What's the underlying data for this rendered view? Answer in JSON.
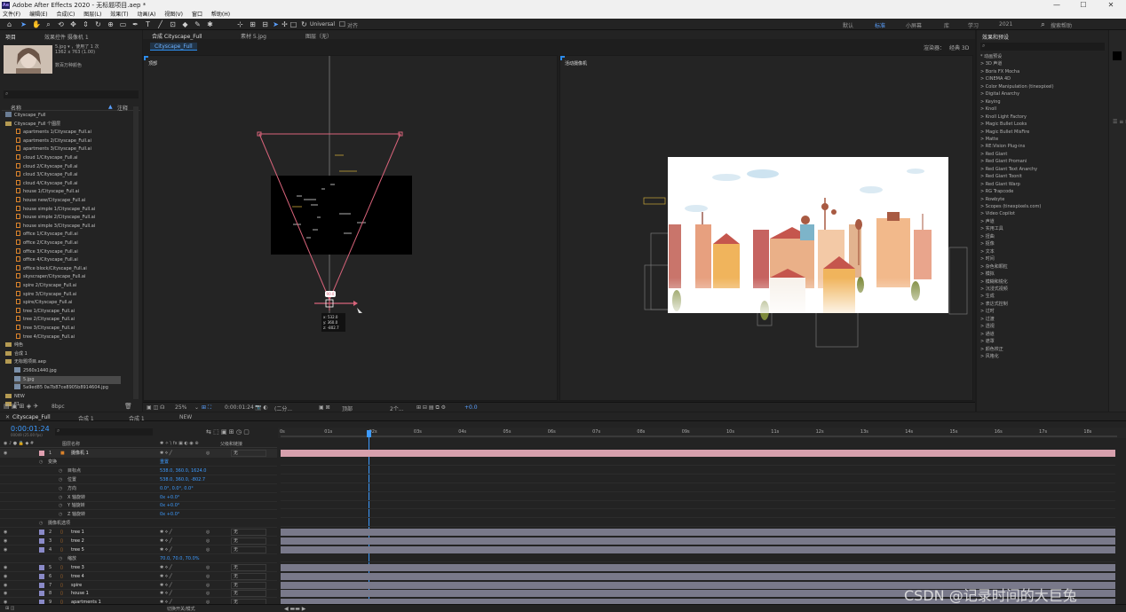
{
  "window": {
    "title": "Adobe After Effects 2020 - 无标题项目.aep *",
    "app_badge": "Ae"
  },
  "menu": [
    "文件(F)",
    "编辑(E)",
    "合成(C)",
    "图层(L)",
    "效果(T)",
    "动画(A)",
    "视图(V)",
    "窗口",
    "帮助(H)"
  ],
  "toolbar": {
    "universal": "Universal",
    "align": "对齐",
    "workspaces": [
      "默认",
      "标准",
      "小屏幕",
      "库",
      "学习",
      "2021"
    ],
    "active_workspace": "标准",
    "search_placeholder": "搜索帮助"
  },
  "project": {
    "tab_project": "项目",
    "tab_effects": "效果控件 摄像机 1",
    "thumb_name": "5.jpg ▾ ，使用了 1 次",
    "thumb_size": "1362 x 763 (1.00)",
    "thumb_color": "数百万种颜色",
    "col_name": "名称",
    "col_note": "注释",
    "items": [
      {
        "type": "comp",
        "label": "Cityscape_Full"
      },
      {
        "type": "folder",
        "label": "Cityscape_Full 个图层"
      },
      {
        "type": "ai",
        "label": "apartments 1/Cityscape_Full.ai"
      },
      {
        "type": "ai",
        "label": "apartments 2/Cityscape_Full.ai"
      },
      {
        "type": "ai",
        "label": "apartments 3/Cityscape_Full.ai"
      },
      {
        "type": "ai",
        "label": "cloud 1/Cityscape_Full.ai"
      },
      {
        "type": "ai",
        "label": "cloud 2/Cityscape_Full.ai"
      },
      {
        "type": "ai",
        "label": "cloud 3/Cityscape_Full.ai"
      },
      {
        "type": "ai",
        "label": "cloud 4/Cityscape_Full.ai"
      },
      {
        "type": "ai",
        "label": "house 1/Cityscape_Full.ai"
      },
      {
        "type": "ai",
        "label": "house new/Cityscape_Full.ai"
      },
      {
        "type": "ai",
        "label": "house simple 1/Cityscape_Full.ai"
      },
      {
        "type": "ai",
        "label": "house simple 2/Cityscape_Full.ai"
      },
      {
        "type": "ai",
        "label": "house simple 3/Cityscape_Full.ai"
      },
      {
        "type": "ai",
        "label": "office 1/Cityscape_Full.ai"
      },
      {
        "type": "ai",
        "label": "office 2/Cityscape_Full.ai"
      },
      {
        "type": "ai",
        "label": "office 3/Cityscape_Full.ai"
      },
      {
        "type": "ai",
        "label": "office 4/Cityscape_Full.ai"
      },
      {
        "type": "ai",
        "label": "office block/Cityscape_Full.ai"
      },
      {
        "type": "ai",
        "label": "skyscraper/Cityscape_Full.ai"
      },
      {
        "type": "ai",
        "label": "spire 2/Cityscape_Full.ai"
      },
      {
        "type": "ai",
        "label": "spire 3/Cityscape_Full.ai"
      },
      {
        "type": "ai",
        "label": "spire/Cityscape_Full.ai"
      },
      {
        "type": "ai",
        "label": "tree 1/Cityscape_Full.ai"
      },
      {
        "type": "ai",
        "label": "tree 2/Cityscape_Full.ai"
      },
      {
        "type": "ai",
        "label": "tree 3/Cityscape_Full.ai"
      },
      {
        "type": "ai",
        "label": "tree 4/Cityscape_Full.ai"
      },
      {
        "type": "folder",
        "label": "纯色"
      },
      {
        "type": "folder",
        "label": "合成 1"
      },
      {
        "type": "folder",
        "label": "无标题项目.aep"
      },
      {
        "type": "img",
        "label": "2560x1440.jpg"
      },
      {
        "type": "img",
        "label": "5.jpg"
      },
      {
        "type": "img",
        "label": "5a9ed85   0a7b87ce8905b8914604.jpg"
      },
      {
        "type": "folder",
        "label": "NEW"
      },
      {
        "type": "folder",
        "label": "F1"
      }
    ],
    "bpc": "8bpc"
  },
  "viewer": {
    "tabs": [
      "合成 Cityscape_Full",
      "素材 5.jpg",
      "图层（无）"
    ],
    "comp_name": "Cityscape_Full",
    "renderer_label": "渲染器：",
    "renderer": "经典 3D",
    "left_view": "顶部",
    "right_view": "活动摄像机",
    "cam_tooltip": {
      "x": "x: 532.0",
      "y": "y: 360.0",
      "z": "z: -802.7"
    },
    "cam_badge": "90.0",
    "zoom": "25%",
    "timecode": "0:00:01:24",
    "resolution": "(二分...",
    "camera": "顶部",
    "views": "2个...",
    "exposure": "+0.0"
  },
  "effects": {
    "title": "效果和预设",
    "items": [
      "* 动画预设",
      "> 3D 声道",
      "> Boris FX Mocha",
      "> CINEMA 4D",
      "> Color Manipulation (tinexpixel)",
      "> Digital Anarchy",
      "> Keying",
      "> Knoll",
      "> Knoll Light Factory",
      "> Magic Bullet Looks",
      "> Magic Bullet MisFire",
      "> Matte",
      "> RE:Vision Plug-ins",
      "> Red Giant",
      "> Red Giant Promani",
      "> Red Giant Text Anarchy",
      "> Red Giant Toonit",
      "> Red Giant Warp",
      "> RG Trapcode",
      "> Rowbyte",
      "> Scopes (tinexpixels.com)",
      "> Video Copilot",
      "> 声道",
      "> 实用工具",
      "> 扭曲",
      "> 抠像",
      "> 文本",
      "> 时间",
      "> 杂色和颗粒",
      "> 模拟",
      "> 模糊和锐化",
      "> 沉浸式视频",
      "> 生成",
      "> 表达式控制",
      "> 过时",
      "> 过渡",
      "> 透视",
      "> 通道",
      "> 遮罩",
      "> 颜色校正",
      "> 风格化"
    ]
  },
  "timeline": {
    "tabs": [
      "Cityscape_Full",
      "合成 1",
      "合成 1",
      "NEW"
    ],
    "timecode": "0:00:01:24",
    "sub_timecode": "00049 (25.00 fps)",
    "col_layer": "图层名称",
    "col_parent": "父级和链接",
    "ruler": [
      "0s",
      "01s",
      "02s",
      "03s",
      "04s",
      "05s",
      "06s",
      "07s",
      "08s",
      "09s",
      "10s",
      "11s",
      "12s",
      "13s",
      "14s",
      "15s",
      "16s",
      "17s",
      "18s"
    ],
    "rows": [
      {
        "num": "1",
        "name": "摄像机 1",
        "kind": "layer",
        "parent": "无"
      },
      {
        "num": "",
        "name": "变换",
        "kind": "group",
        "value": "重置"
      },
      {
        "num": "",
        "name": "目标点",
        "kind": "prop",
        "value": "538.0, 360.0, 1624.0"
      },
      {
        "num": "",
        "name": "位置",
        "kind": "prop",
        "value": "538.0, 360.0, -802.7"
      },
      {
        "num": "",
        "name": "方向",
        "kind": "prop",
        "value": "0.0°, 0.0°, 0.0°"
      },
      {
        "num": "",
        "name": "X 轴旋转",
        "kind": "prop",
        "value": "0x +0.0°"
      },
      {
        "num": "",
        "name": "Y 轴旋转",
        "kind": "prop",
        "value": "0x +0.0°"
      },
      {
        "num": "",
        "name": "Z 轴旋转",
        "kind": "prop",
        "value": "0x +0.0°"
      },
      {
        "num": "",
        "name": "摄像机选项",
        "kind": "group",
        "value": ""
      },
      {
        "num": "2",
        "name": "tree 1",
        "kind": "layer",
        "parent": "无"
      },
      {
        "num": "3",
        "name": "tree 2",
        "kind": "layer",
        "parent": "无"
      },
      {
        "num": "4",
        "name": "tree 5",
        "kind": "layer",
        "parent": "无"
      },
      {
        "num": "",
        "name": "缩放",
        "kind": "prop",
        "value": "70.0, 70.0, 70.0%"
      },
      {
        "num": "5",
        "name": "tree 3",
        "kind": "layer",
        "parent": "无"
      },
      {
        "num": "6",
        "name": "tree 4",
        "kind": "layer",
        "parent": "无"
      },
      {
        "num": "7",
        "name": "spire",
        "kind": "layer",
        "parent": "无"
      },
      {
        "num": "8",
        "name": "house 1",
        "kind": "layer",
        "parent": "无"
      },
      {
        "num": "9",
        "name": "apartments 1",
        "kind": "layer",
        "parent": "无"
      }
    ],
    "footer": "切换开关/模式"
  },
  "watermark": "CSDN @记录时间的大巨兔",
  "colors": {
    "accent": "#2d8ceb",
    "camera_line": "#d8637a",
    "selected_bar": "#d7a0ad",
    "bar": "#79798a",
    "label_camera": "#e0a0b0",
    "label_layer": "#8a8ac8"
  }
}
